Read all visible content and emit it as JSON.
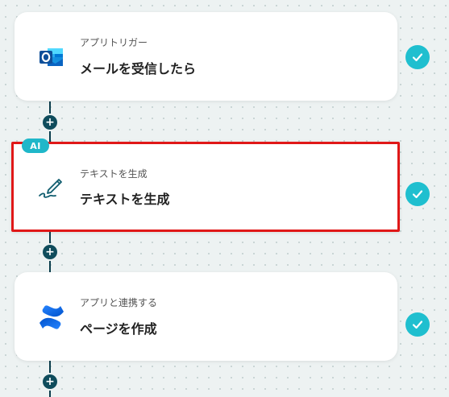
{
  "colors": {
    "accent": "#1fbfcf",
    "connector": "#0f4c5c",
    "selection": "#e01818",
    "background": "#edf2f2"
  },
  "steps": [
    {
      "label": "アプリトリガー",
      "title": "メールを受信したら",
      "icon": "outlook-icon",
      "status": "completed"
    },
    {
      "label": "テキストを生成",
      "title": "テキストを生成",
      "icon": "ai-pen-icon",
      "badge": "AI",
      "status": "completed",
      "selected": true
    },
    {
      "label": "アプリと連携する",
      "title": "ページを作成",
      "icon": "confluence-icon",
      "status": "completed"
    }
  ],
  "add_step_symbol": "+"
}
